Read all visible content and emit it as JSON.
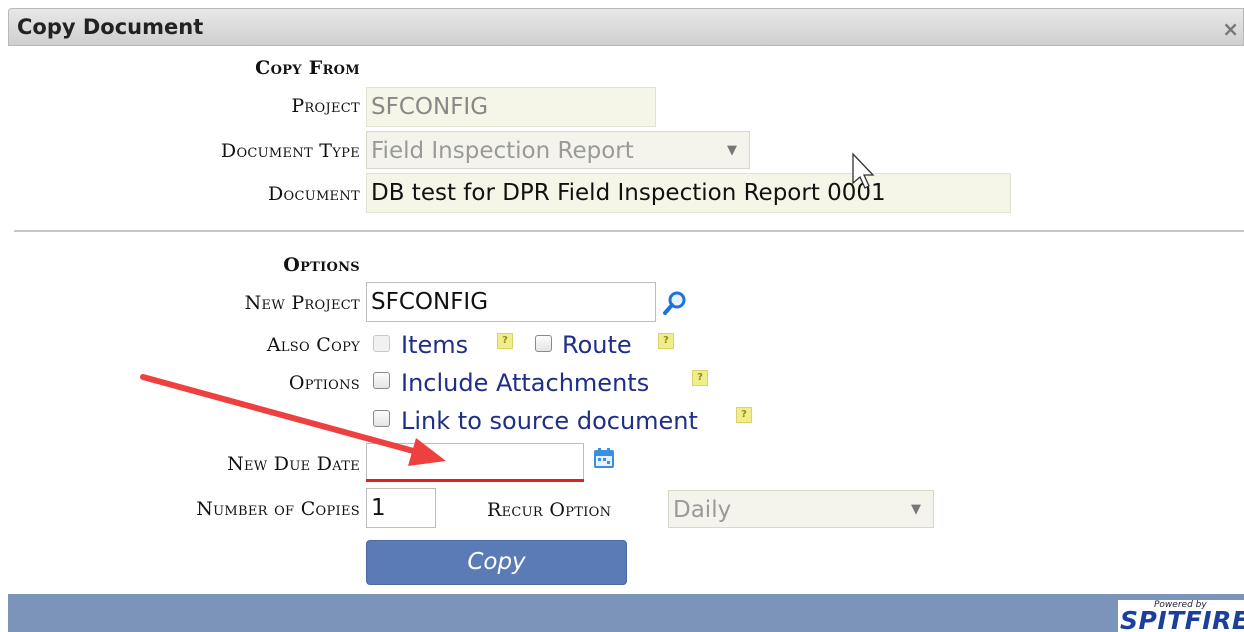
{
  "dialog": {
    "title": "Copy Document",
    "close_icon": "×"
  },
  "copy_from": {
    "heading": "Copy From",
    "project_label": "Project",
    "project_value": "SFCONFIG",
    "document_type_label": "Document Type",
    "document_type_value": "Field Inspection Report",
    "document_label": "Document",
    "document_value": "DB test for DPR Field Inspection Report 0001"
  },
  "options": {
    "heading": "Options",
    "new_project_label": "New Project",
    "new_project_value": "SFCONFIG",
    "also_copy_label": "Also Copy",
    "items_label": "Items",
    "route_label": "Route",
    "options_label": "Options",
    "include_attachments_label": "Include Attachments",
    "link_source_label": "Link to source document",
    "new_due_date_label": "New Due Date",
    "new_due_date_value": "",
    "number_of_copies_label": "Number of Copies",
    "number_of_copies_value": "1",
    "recur_option_label": "Recur Option",
    "recur_option_value": "Daily",
    "help_glyph": "?"
  },
  "actions": {
    "copy_label": "Copy"
  },
  "footer": {
    "powered_by": "Powered by",
    "brand": "SPITFIRE"
  },
  "colors": {
    "accent_button": "#5a7bb5",
    "footer": "#7c94b9",
    "annotation": "#e02020",
    "link_text": "#1f2f86"
  },
  "icons": [
    "close-icon",
    "dropdown-arrow-icon",
    "magnifier-icon",
    "calendar-icon",
    "help-icon",
    "mouse-cursor-icon",
    "red-arrow-annotation"
  ]
}
